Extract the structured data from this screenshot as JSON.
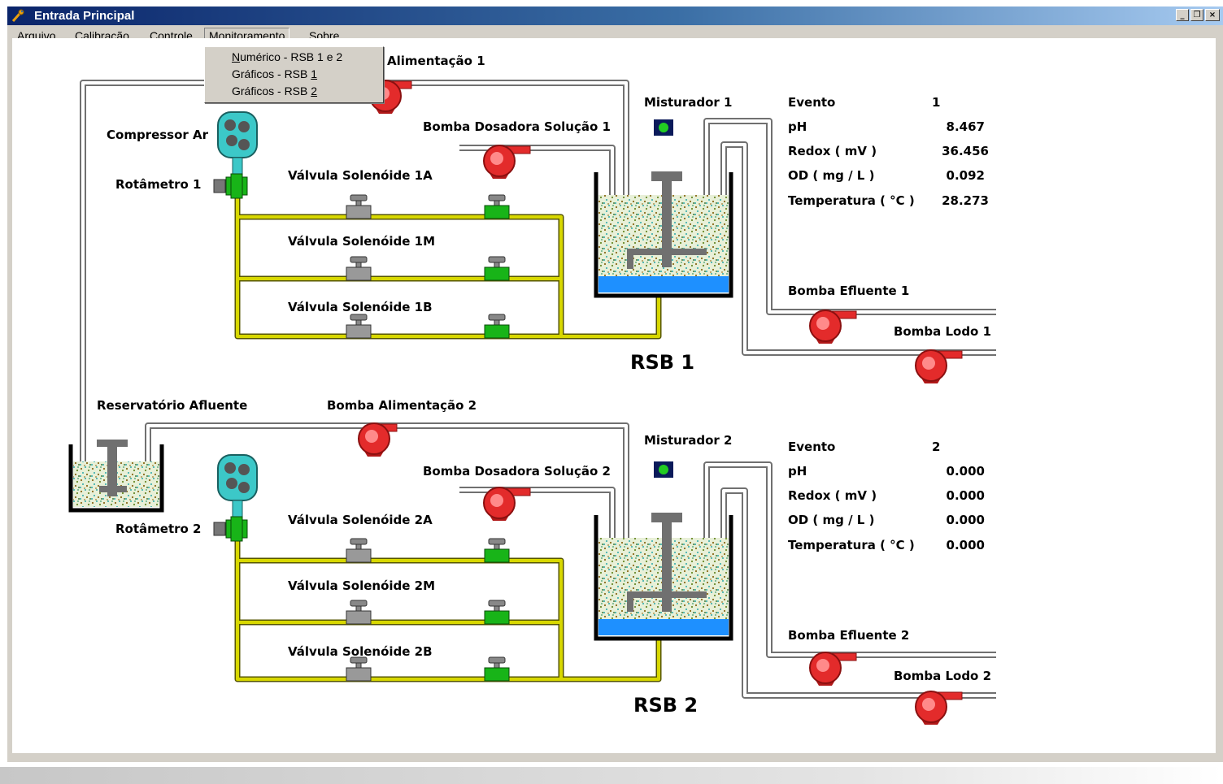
{
  "window": {
    "title": "Entrada Principal"
  },
  "caption_buttons": {
    "minimize": "_",
    "restore": "❐",
    "close": "×"
  },
  "menubar": {
    "items": [
      {
        "label": "Arquivo",
        "accel": "A",
        "rest": "rquivo"
      },
      {
        "label": "Calibração",
        "accel": "C",
        "rest": "alibração"
      },
      {
        "label": "Controle",
        "pre": "C",
        "accel": "o",
        "rest": "ntrole"
      },
      {
        "label": "Monitoramento",
        "accel": "M",
        "rest": "onitoramento"
      },
      {
        "label": "Sobre",
        "accel": "S",
        "rest": "obre"
      }
    ]
  },
  "dropdown": {
    "items": [
      {
        "label": "Numérico - RSB 1 e 2",
        "pre": "",
        "accel": "N",
        "rest": "umérico - RSB 1 e 2"
      },
      {
        "label": "Gráficos - RSB 1",
        "pre": "Gráficos - RSB ",
        "accel": "1",
        "rest": ""
      },
      {
        "label": "Gráficos - RSB 2",
        "pre": "Gráficos - RSB ",
        "accel": "2",
        "rest": ""
      }
    ]
  },
  "labels": {
    "alimentacao1": "Alimentação 1",
    "compressor": "Compressor Ar",
    "rotametro1": "Rotâmetro 1",
    "rotametro2": "Rotâmetro 2",
    "misturador1": "Misturador 1",
    "misturador2": "Misturador 2",
    "dosadora1": "Bomba Dosadora Solução 1",
    "dosadora2": "Bomba Dosadora Solução 2",
    "v1a": "Válvula Solenóide 1A",
    "v1m": "Válvula Solenóide 1M",
    "v1b": "Válvula Solenóide 1B",
    "v2a": "Válvula Solenóide 2A",
    "v2m": "Válvula Solenóide 2M",
    "v2b": "Válvula Solenóide 2B",
    "efluente1": "Bomba Efluente 1",
    "efluente2": "Bomba Efluente 2",
    "lodo1": "Bomba Lodo 1",
    "lodo2": "Bomba Lodo 2",
    "rsb1": "RSB 1",
    "rsb2": "RSB 2",
    "reservatorio": "Reservatório Afluente",
    "alimentacao2": "Bomba Alimentação 2"
  },
  "readings": {
    "rsb1": {
      "evento_label": "Evento",
      "evento": "1",
      "ph_label": "pH",
      "ph": "8.467",
      "redox_label": "Redox  ( mV )",
      "redox": "36.456",
      "od_label": "OD  ( mg / L )",
      "od": "0.092",
      "temp_label": "Temperatura  ( °C )",
      "temp": "28.273"
    },
    "rsb2": {
      "evento_label": "Evento",
      "evento": "2",
      "ph_label": "pH",
      "ph": "0.000",
      "redox_label": "Redox  ( mV )",
      "redox": "0.000",
      "od_label": "OD  ( mg / L )",
      "od": "0.000",
      "temp_label": "Temperatura  ( °C )",
      "temp": "0.000"
    }
  },
  "colors": {
    "title_bar": "#0a246a",
    "pump": "#e32b2b",
    "air_pipe": "#c8c800",
    "water": "#1e90ff",
    "mixer_led": "#22cc22",
    "valve_green": "#18b418",
    "compressor": "#3cc8c8"
  },
  "icons": {
    "app": "wrench-icon",
    "pump": "pump-icon",
    "valve": "solenoid-valve-icon",
    "compressor": "compressor-icon",
    "rotameter": "rotameter-icon",
    "mixer": "mixer-indicator-icon"
  }
}
